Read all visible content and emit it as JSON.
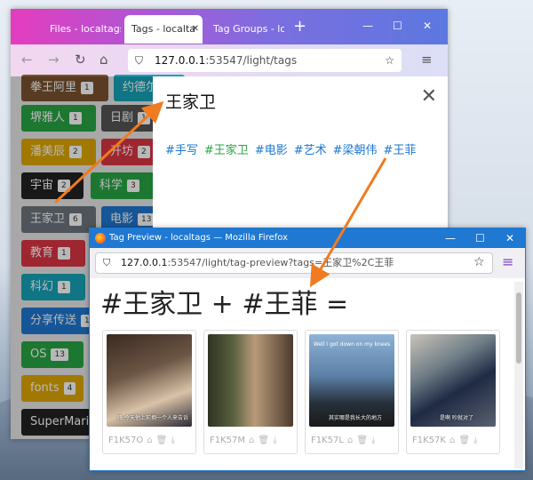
{
  "back_window": {
    "tabs": [
      {
        "label": "Files - localtags"
      },
      {
        "label": "Tags - localta"
      },
      {
        "label": "Tag Groups - lo"
      }
    ],
    "close_glyph": "✕",
    "plus": "+",
    "controls": {
      "min": "—",
      "max": "☐",
      "close": "✕"
    },
    "url": {
      "host": "127.0.0.1",
      "rest": ":53547/light/tags"
    },
    "tags": [
      {
        "name": "拳王阿里",
        "count": "1",
        "color": "#7a5230"
      },
      {
        "name": "约德尔",
        "count": "",
        "color": "#17a2b8"
      },
      {
        "name": "堺雅人",
        "count": "1",
        "color": "#28a745"
      },
      {
        "name": "日剧",
        "count": "1",
        "color": "#555555"
      },
      {
        "name": "潘美辰",
        "count": "2",
        "color": "#e0a800"
      },
      {
        "name": "开坊",
        "count": "2",
        "color": "#dc3545"
      },
      {
        "name": "宇宙",
        "count": "2",
        "color": "#222222"
      },
      {
        "name": "科学",
        "count": "3",
        "color": "#28a745"
      },
      {
        "name": "王家卫",
        "count": "6",
        "color": "#6c757d"
      },
      {
        "name": "电影",
        "count": "13",
        "color": "#1f78d1"
      },
      {
        "name": "教育",
        "count": "1",
        "color": "#dc3545"
      },
      {
        "name": "科幻",
        "count": "1",
        "color": "#17a2b8"
      },
      {
        "name": "分享传送",
        "count": "1",
        "color": "#1f78d1"
      },
      {
        "name": "OS",
        "count": "13",
        "color": "#28a745"
      },
      {
        "name": "fonts",
        "count": "4",
        "color": "#e0a800"
      },
      {
        "name": "SuperMario",
        "count": "",
        "color": "#222222"
      }
    ],
    "modal": {
      "title": "王家卫",
      "close": "✕",
      "tags": [
        "#手写",
        "#王家卫",
        "#电影",
        "#艺术",
        "#梁朝伟",
        "#王菲"
      ]
    }
  },
  "front_window": {
    "title": "Tag Preview - localtags — Mozilla Firefox",
    "controls": {
      "min": "—",
      "max": "☐",
      "close": "✕"
    },
    "url": {
      "host": "127.0.0.1",
      "rest": ":53547/light/tag-preview?tags=王家卫%2C王菲"
    },
    "heading": "#王家卫 + #王菲 =",
    "cards": [
      {
        "id": "F1K57O",
        "subtitle": "嗨 今天他上前拥一个人来告诉",
        "top": ""
      },
      {
        "id": "F1K57M",
        "subtitle": "",
        "top": ""
      },
      {
        "id": "F1K57L",
        "subtitle": "其实哪是我长大的地方",
        "top": "Well I got down on my knees"
      },
      {
        "id": "F1K57K",
        "subtitle": "是啊 吵就对了",
        "top": ""
      }
    ],
    "card_icons": {
      "tag": "⌂",
      "trash": "🗑",
      "download": "⤓"
    }
  },
  "colors": {
    "arrow": "#f07b20",
    "link": "#1a76d2",
    "current_link": "#28a745"
  }
}
